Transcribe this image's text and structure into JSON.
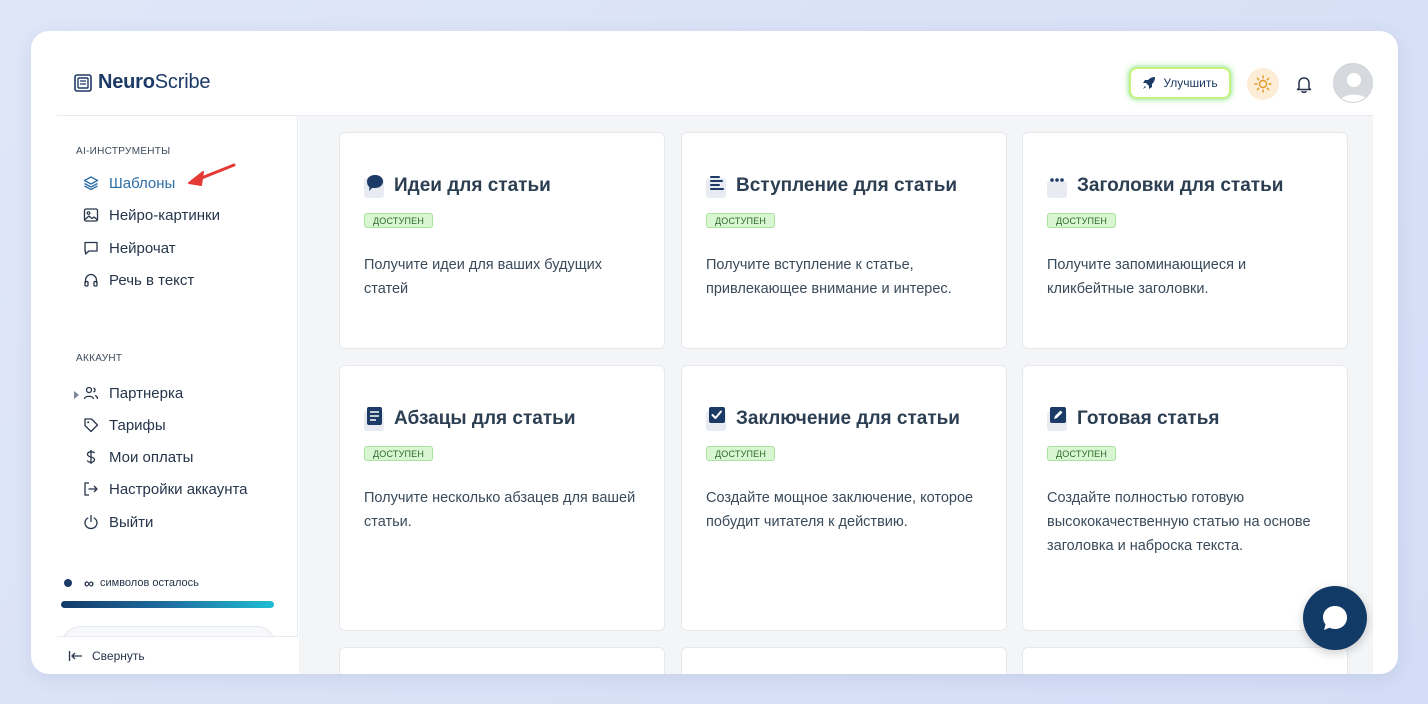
{
  "header": {
    "logo_bold": "Neuro",
    "logo_light": "Scribe",
    "upgrade_label": "Улучшить"
  },
  "sidebar": {
    "section_tools": "AI-ИНСТРУМЕНТЫ",
    "tools": [
      {
        "label": "Шаблоны",
        "icon": "layers-icon"
      },
      {
        "label": "Нейро-картинки",
        "icon": "image-icon"
      },
      {
        "label": "Нейрочат",
        "icon": "chat-bubble-icon"
      },
      {
        "label": "Речь в текст",
        "icon": "headphones-icon"
      }
    ],
    "section_account": "АККАУНТ",
    "account": [
      {
        "label": "Партнерка",
        "icon": "users-icon"
      },
      {
        "label": "Тарифы",
        "icon": "tag-icon"
      },
      {
        "label": "Мои оплаты",
        "icon": "dollar-icon"
      },
      {
        "label": "Настройки аккаунта",
        "icon": "login-arrow-icon"
      },
      {
        "label": "Выйти",
        "icon": "power-icon"
      }
    ],
    "credits_value": "∞",
    "credits_label": "символов осталось",
    "collapse_label": "Свернуть"
  },
  "cards": [
    {
      "title": "Идеи для статьи",
      "badge": "доступен",
      "desc": "Получите идеи для ваших будущих статей"
    },
    {
      "title": "Вступление для статьи",
      "badge": "доступен",
      "desc": "Получите вступление к статье, привлекающее внимание и интерес."
    },
    {
      "title": "Заголовки для статьи",
      "badge": "доступен",
      "desc": "Получите запоминающиеся и кликбейтные заголовки."
    },
    {
      "title": "Абзацы для статьи",
      "badge": "доступен",
      "desc": "Получите несколько абзацев для вашей статьи."
    },
    {
      "title": "Заключение для статьи",
      "badge": "доступен",
      "desc": "Создайте мощное заключение, которое побудит читателя к действию."
    },
    {
      "title": "Готовая статья",
      "badge": "доступен",
      "desc": "Создайте полностью готовую высококачественную статью на основе заголовка и наброска текста."
    }
  ],
  "colors": {
    "brand": "#1b3a66",
    "active_nav": "#2d6ea6",
    "badge_bg": "#d8f6d2",
    "annotation_arrow": "#e53935"
  }
}
